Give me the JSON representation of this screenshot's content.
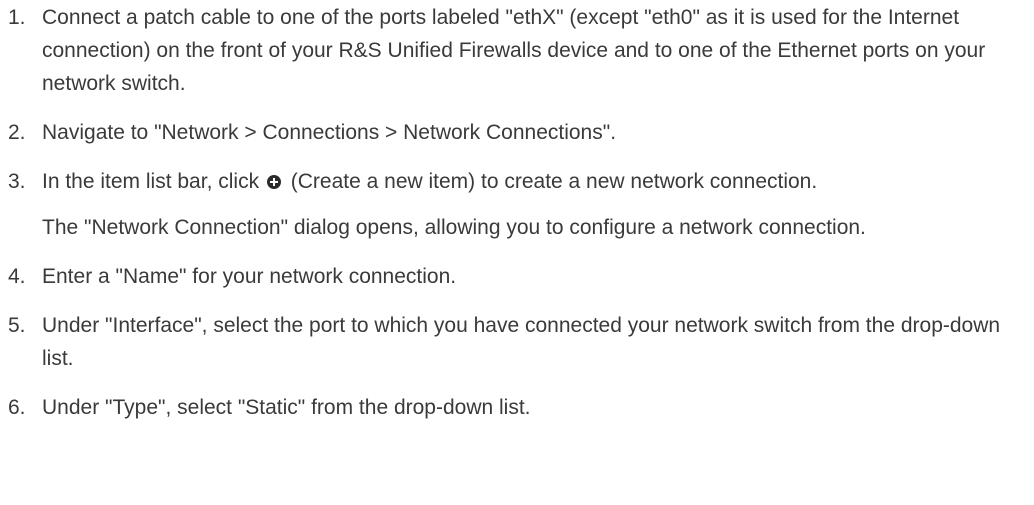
{
  "steps": [
    {
      "number": "1.",
      "text": "Connect a patch cable to one of the ports labeled \"ethX\" (except \"eth0\" as it is used for the Internet connection) on the front of your R&S Unified Firewalls device and to one of the Ethernet ports on your network switch."
    },
    {
      "number": "2.",
      "text": "Navigate to \"Network > Connections > Network Connections\"."
    },
    {
      "number": "3.",
      "text_before_icon": "In the item list bar, click",
      "icon": "plus-circle-icon",
      "text_after_icon": "(Create a new item) to create a new network connection.",
      "result": "The \"Network Connection\" dialog opens, allowing you to configure a network connection."
    },
    {
      "number": "4.",
      "text": "Enter a \"Name\" for your network connection."
    },
    {
      "number": "5.",
      "text": "Under \"Interface\", select the port to which you have connected your network switch from the drop-down list."
    },
    {
      "number": "6.",
      "text": "Under \"Type\", select \"Static\" from the drop-down list."
    }
  ]
}
